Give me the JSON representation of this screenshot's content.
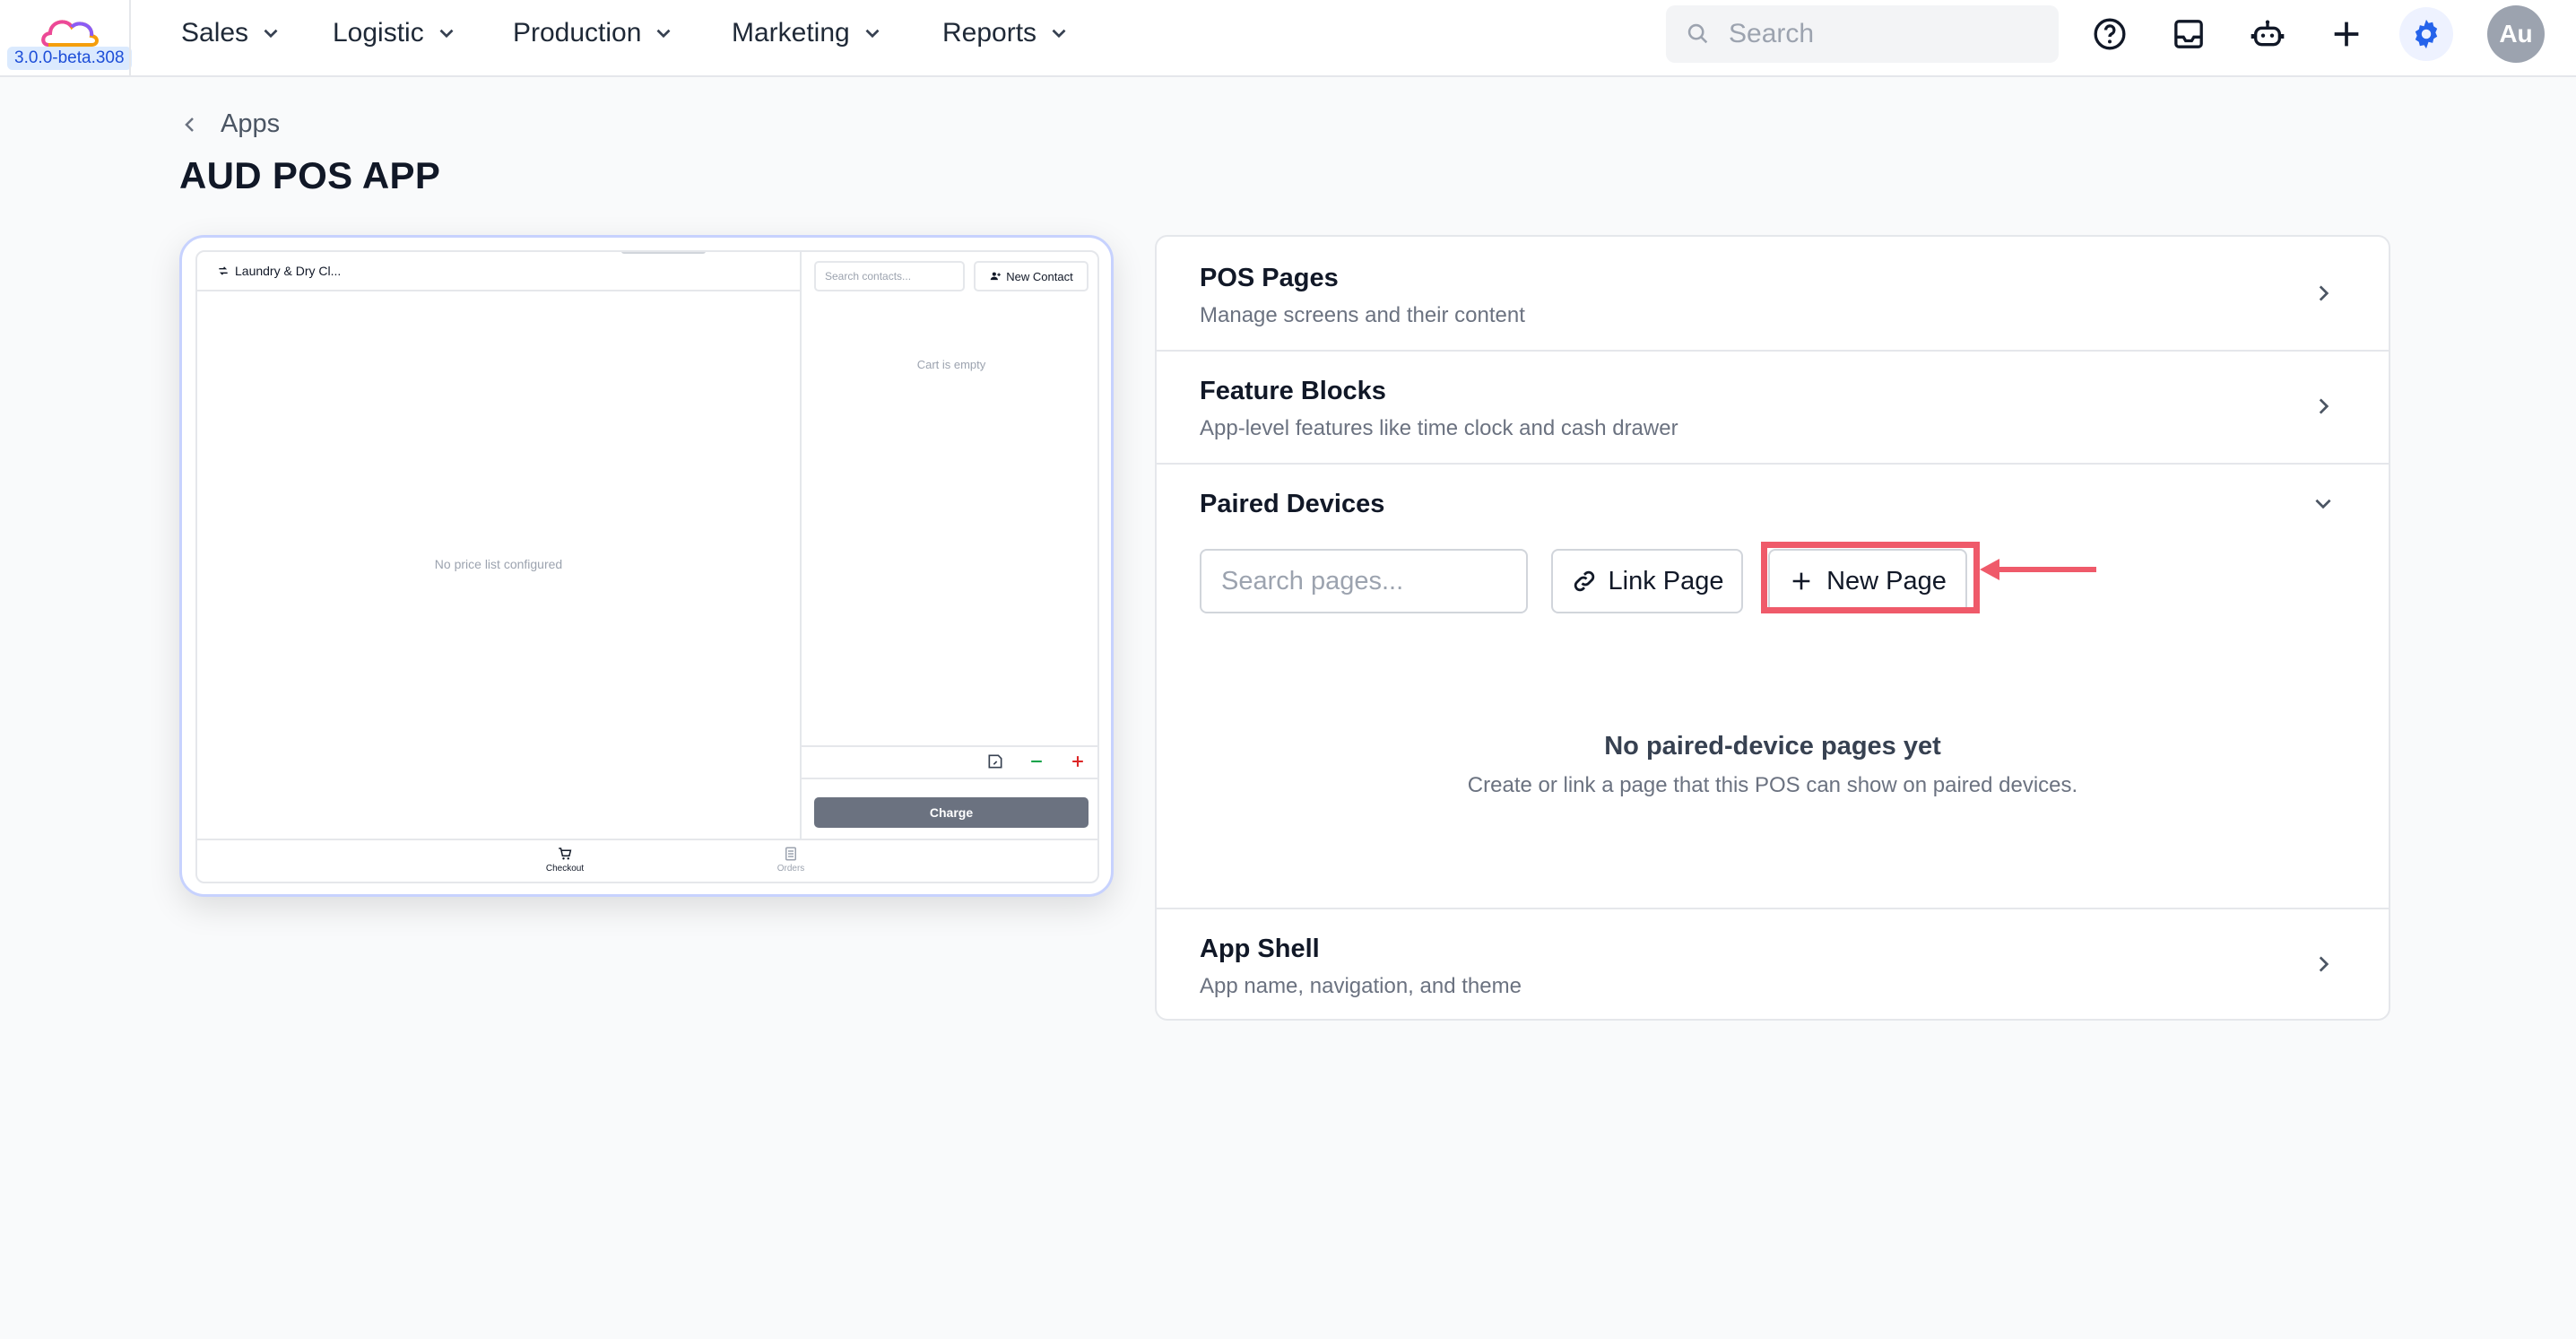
{
  "app": {
    "version": "3.0.0-beta.308",
    "colors": {
      "accent": "#2563eb",
      "highlight": "#ef5a6a"
    }
  },
  "nav": {
    "menus": [
      {
        "label": "Sales"
      },
      {
        "label": "Logistic"
      },
      {
        "label": "Production"
      },
      {
        "label": "Marketing"
      },
      {
        "label": "Reports"
      }
    ],
    "search_placeholder": "Search",
    "icons": [
      "help-icon",
      "inbox-icon",
      "bot-icon",
      "plus-icon",
      "settings-icon"
    ],
    "avatar": "Au"
  },
  "header": {
    "back_label": "Apps",
    "title": "AUD POS APP"
  },
  "preview": {
    "location": "Laundry & Dry Cl...",
    "empty_left": "No price list configured",
    "search_placeholder": "Search contacts...",
    "new_contact": "New Contact",
    "cart_empty": "Cart is empty",
    "charge": "Charge",
    "tabs": [
      {
        "label": "Checkout"
      },
      {
        "label": "Orders"
      }
    ]
  },
  "sections": {
    "pos_pages": {
      "title": "POS Pages",
      "desc": "Manage screens and their content"
    },
    "feature_blocks": {
      "title": "Feature Blocks",
      "desc": "App-level features like time clock and cash drawer"
    },
    "paired_devices": {
      "title": "Paired Devices",
      "search_placeholder": "Search pages...",
      "link_page": "Link Page",
      "new_page": "New Page",
      "empty_title": "No paired-device pages yet",
      "empty_desc": "Create or link a page that this POS can show on paired devices."
    },
    "app_shell": {
      "title": "App Shell",
      "desc": "App name, navigation, and theme"
    }
  }
}
